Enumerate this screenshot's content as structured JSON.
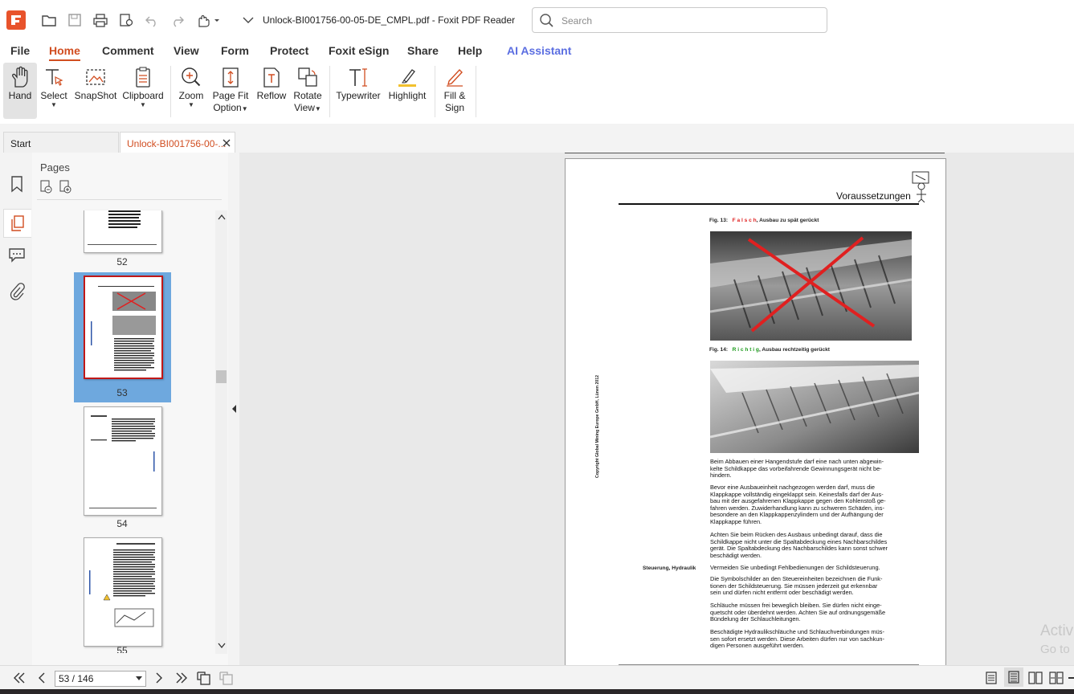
{
  "window": {
    "doc_title": "Unlock-BI001756-00-05-DE_CMPL.pdf - Foxit PDF Reader",
    "search_placeholder": "Search"
  },
  "menu": [
    "File",
    "Home",
    "Comment",
    "View",
    "Form",
    "Protect",
    "Foxit eSign",
    "Share",
    "Help",
    "AI Assistant"
  ],
  "ribbon": {
    "hand": "Hand",
    "select": "Select",
    "snapshot": "SnapShot",
    "clipboard": "Clipboard",
    "zoom": "Zoom",
    "pagefit_1": "Page Fit",
    "pagefit_2": "Option",
    "reflow": "Reflow",
    "rotate_1": "Rotate",
    "rotate_2": "View",
    "typewriter": "Typewriter",
    "highlight": "Highlight",
    "fillsign_1": "Fill &",
    "fillsign_2": "Sign"
  },
  "tabs": {
    "start": "Start",
    "doc": "Unlock-BI001756-00-..."
  },
  "pages_panel": {
    "title": "Pages",
    "page_numbers": [
      "52",
      "53",
      "54",
      "55"
    ],
    "selected": "53"
  },
  "pdf": {
    "header": "Voraussetzungen",
    "fig13_label": "Fig. 13:",
    "fig13_word": "F a l s c h",
    "fig13_text": ", Ausbau zu spät gerückt",
    "fig14_label": "Fig. 14:",
    "fig14_word": "R i c h t i g",
    "fig14_text": ", Ausbau rechtzeitig gerückt",
    "side_vertical": "Copyright Global Mining Europe GmbH, Lünen 2012",
    "side_label": "Steuerung, Hydraulik",
    "paragraphs": [
      [
        "Beim Abbauen einer Hangendstufe darf eine nach unten abgewin-",
        "kelte Schildkappe das vorbeifahrende Gewinnungsgerät nicht be-",
        "hindern."
      ],
      [
        "Bevor eine Ausbaueinheit nachgezogen werden darf, muss die",
        "Klappkappe vollständig eingeklappt sein. Keinesfalls darf der Aus-",
        "bau mit der ausgefahrenen Klappkappe gegen den Kohlenstoß ge-",
        "fahren werden. Zuwiderhandlung kann zu schweren Schäden, ins-",
        "besondere an den Klappkappenzylindern und der Aufhängung der",
        "Klappkappe führen."
      ],
      [
        "Achten Sie beim Rücken des Ausbaus unbedingt darauf, dass die",
        "Schildkappe nicht unter die Spaltabdeckung eines Nachbarschildes",
        "gerät. Die Spaltabdeckung des Nachbarschildes kann sonst schwer",
        "beschädigt werden."
      ],
      [
        "Vermeiden Sie unbedingt Fehlbedienungen der Schildsteuerung."
      ],
      [
        "Die Symbolschilder an den Steuereinheiten bezeichnen die Funk-",
        "tionen der Schildsteuerung. Sie müssen jederzeit gut erkennbar",
        "sein und dürfen nicht entfernt oder beschädigt werden."
      ],
      [
        "Schläuche müssen frei beweglich bleiben. Sie dürfen nicht einge-",
        "quetscht oder überdehnt werden. Achten Sie auf ordnungsgemäße",
        "Bündelung der Schlauchleitungen."
      ],
      [
        "Beschädigte Hydraulikschläuche und Schlauchverbindungen müs-",
        "sen sofort ersetzt werden. Diese Arbeiten dürfen nur von sachkun-",
        "digen Personen ausgeführt werden."
      ]
    ]
  },
  "status": {
    "page_field": "53 / 146"
  },
  "watermark": {
    "line1": "Activ",
    "line2": "Go to"
  },
  "colors": {
    "accent": "#d14d20",
    "ai": "#5b6ee1",
    "wrong": "#e02020",
    "right": "#1a9a1a",
    "selection": "#6ea8de"
  }
}
